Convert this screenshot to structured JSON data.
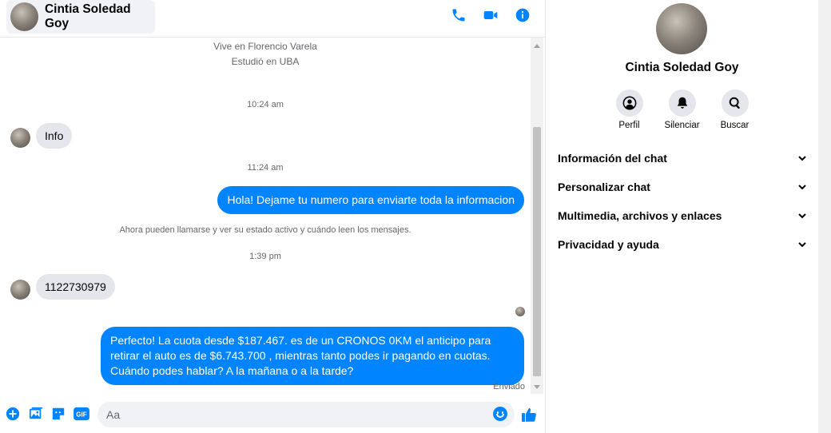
{
  "header": {
    "name": "Cintia Soledad Goy",
    "icons": [
      "phone-icon",
      "video-camera-icon",
      "info-icon"
    ]
  },
  "chat": {
    "intro": {
      "location": "Vive en Florencio Varela",
      "education": "Estudió en UBA"
    },
    "messages": [
      {
        "type": "timestamp",
        "text": "10:24 am"
      },
      {
        "type": "incoming",
        "text": "Info"
      },
      {
        "type": "timestamp",
        "text": "11:24 am"
      },
      {
        "type": "outgoing",
        "text": "Hola! Dejame tu numero  para enviarte toda la informacion"
      },
      {
        "type": "system",
        "text": "Ahora pueden llamarse y ver su estado activo y cuándo leen los mensajes."
      },
      {
        "type": "timestamp",
        "text": "1:39 pm"
      },
      {
        "type": "incoming",
        "text": "1122730979"
      },
      {
        "type": "outgoing",
        "text": "Perfecto! La cuota desde $187.467. es de un CRONOS 0KM el anticipo para retirar el auto es de $6.743.700 , mientras tanto podes ir pagando en cuotas. Cuándo podes hablar? A la mañana o a la tarde?"
      }
    ],
    "status": "Enviado"
  },
  "composer": {
    "placeholder": "Aa",
    "icons": [
      "plus-circle-icon",
      "image-icon",
      "sticker-icon",
      "gif-icon",
      "emoji-icon",
      "thumbs-up-icon"
    ],
    "gif_label": "GIF"
  },
  "profile": {
    "name": "Cintia Soledad Goy",
    "actions": [
      {
        "label": "Perfil",
        "icon": "profile-icon"
      },
      {
        "label": "Silenciar",
        "icon": "bell-icon"
      },
      {
        "label": "Buscar",
        "icon": "search-icon"
      }
    ],
    "sections": [
      {
        "label": "Información del chat"
      },
      {
        "label": "Personalizar chat"
      },
      {
        "label": "Multimedia, archivos y enlaces"
      },
      {
        "label": "Privacidad y ayuda"
      }
    ]
  },
  "colors": {
    "accent": "#0084ff",
    "incoming_bubble": "#e4e6eb",
    "secondary_text": "#65676b"
  }
}
